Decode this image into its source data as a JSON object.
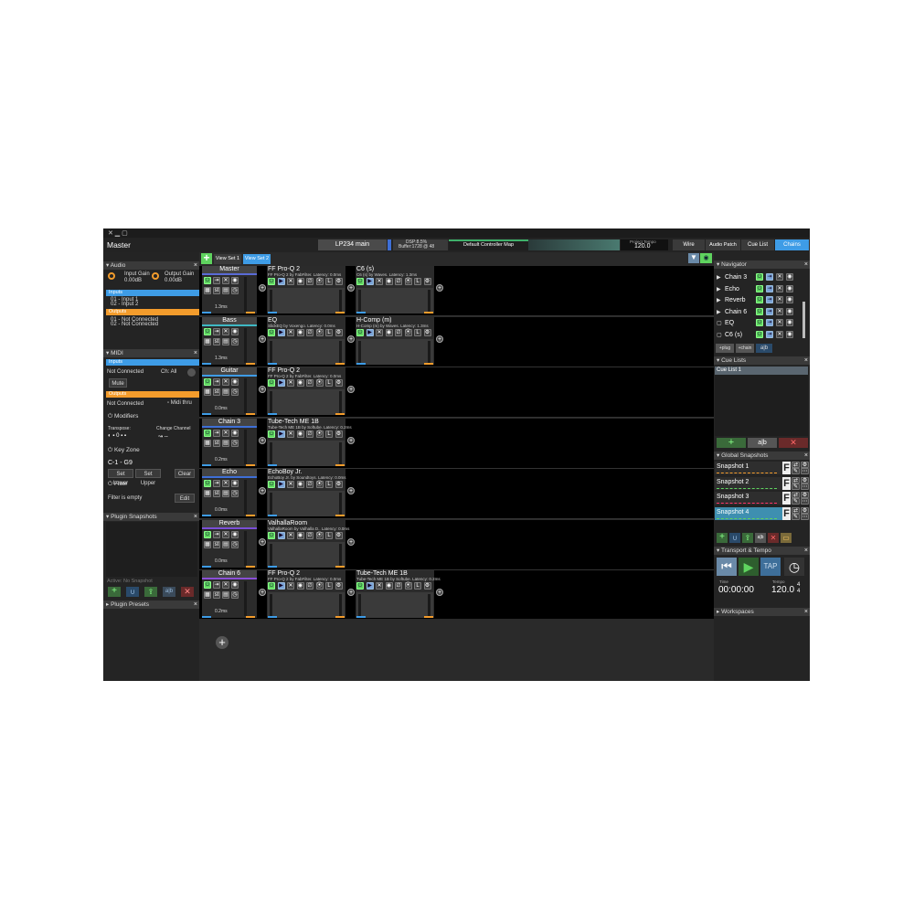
{
  "window": {
    "title": "Master"
  },
  "topbar": {
    "preset": "LP234 main",
    "dsp": "DSP:8.5%",
    "buffer": "Buffer:1728 @ 48",
    "controller_map": "Default Controller Map",
    "tempo_label": "Project Tempo",
    "tempo_value": "120.0",
    "tabs": [
      "Wire",
      "Audio Patch",
      "Cue List",
      "Chains"
    ],
    "active_tab": "Chains"
  },
  "viewsets": [
    "View Set 1",
    "View Set 2"
  ],
  "audio": {
    "title": "Audio",
    "input_gain_label": "Input Gain",
    "input_gain": "0.00dB",
    "output_gain_label": "Output Gain",
    "output_gain": "0.00dB",
    "inputs_label": "Inputs",
    "inputs": [
      "01 - Input 1",
      "02 - Input 2"
    ],
    "outputs_label": "Outputs",
    "outputs": [
      "01 - Not Connected",
      "02 - Not Connected"
    ]
  },
  "midi": {
    "title": "MIDI",
    "inputs_label": "Inputs",
    "input_status": "Not Connected",
    "channel": "Ch: All",
    "mute": "Mute",
    "outputs_label": "Outputs",
    "output_status": "Not Connected",
    "midi_thru": "Midi thru",
    "modifiers": "Modifiers",
    "transpose_label": "Transpose:",
    "transpose_value": "0",
    "change_channel_label": "Change Channel",
    "change_channel_value": "--",
    "key_zone": "Key Zone",
    "range": "C-1 - G9",
    "set_lower": "Set Lower",
    "set_upper": "Set Upper",
    "clear": "Clear",
    "filter": "Filter",
    "filter_status": "Filter is empty",
    "edit": "Edit"
  },
  "plugin_snapshots": {
    "title": "Plugin Snapshots",
    "active": "Active: No Snapshot"
  },
  "plugin_presets": {
    "title": "Plugin Presets"
  },
  "chains": [
    {
      "name": "Master",
      "color": "#5a6bd6",
      "latency": "1.3ms",
      "plugins": [
        {
          "name": "FF Pro-Q 2",
          "sub": "FF Pro-Q 2 by FabFilter. Latency: 0.0ms"
        },
        {
          "name": "C6 (s)",
          "sub": "C6 (s) by Waves. Latency: 1.3ms"
        }
      ]
    },
    {
      "name": "Bass",
      "color": "#3fb8c4",
      "latency": "1.3ms",
      "plugins": [
        {
          "name": "EQ",
          "sub": "SlickEQ by Voxengo. Latency: 0.0ms"
        },
        {
          "name": "H-Comp (m)",
          "sub": "H-Comp (m) by Waves. Latency: 1.3ms"
        }
      ]
    },
    {
      "name": "Guitar",
      "color": "#3e9ce6",
      "latency": "0.0ms",
      "plugins": [
        {
          "name": "FF Pro-Q 2",
          "sub": "FF Pro-Q 2 by FabFilter. Latency: 0.0ms"
        }
      ]
    },
    {
      "name": "Chain 3",
      "color": "#3e6fd6",
      "latency": "0.2ms",
      "plugins": [
        {
          "name": "Tube-Tech ME 1B",
          "sub": "Tube-Tech ME 1B by Softube. Latency: 0.2ms"
        }
      ]
    },
    {
      "name": "Echo",
      "color": "#3e6fd6",
      "latency": "0.0ms",
      "plugins": [
        {
          "name": "EchoBoy Jr.",
          "sub": "EchoBoy Jr. by Soundtoys. Latency: 0.0ms"
        }
      ]
    },
    {
      "name": "Reverb",
      "color": "#7a4fd6",
      "latency": "0.0ms",
      "plugins": [
        {
          "name": "ValhallaRoom",
          "sub": "ValhallaRoom by Valhalla D.. Latency: 0.0ms"
        }
      ]
    },
    {
      "name": "Chain 6",
      "color": "#8a4fd6",
      "latency": "0.2ms",
      "plugins": [
        {
          "name": "FF Pro-Q 2",
          "sub": "FF Pro-Q 2 by FabFilter. Latency: 0.0ms"
        },
        {
          "name": "Tube-Tech ME 1B",
          "sub": "Tube-Tech ME 1B by Softube. Latency: 0.2ms"
        }
      ]
    }
  ],
  "navigator": {
    "title": "Navigator",
    "items": [
      "Chain 3",
      "Echo",
      "Reverb",
      "Chain 6",
      "EQ",
      "C6 (s)"
    ],
    "add_plug": "+plug",
    "add_chain": "+chain"
  },
  "cue_lists": {
    "title": "Cue Lists",
    "items": [
      "Cue List 1"
    ]
  },
  "global_snapshots": {
    "title": "Global Snapshots",
    "items": [
      "Snapshot 1",
      "Snapshot 2",
      "Snapshot 3",
      "Snapshot 4"
    ],
    "selected": "Snapshot 4"
  },
  "transport": {
    "title": "Transport & Tempo",
    "tap": "TAP",
    "time_label": "Time",
    "time": "00:00:00",
    "tempo_label": "Tempo",
    "tempo": "120.0",
    "sig_top": "4",
    "sig_bottom": "4"
  },
  "workspaces": {
    "title": "Workspaces"
  },
  "colors": {
    "accent": "#3e9ce6",
    "orange": "#f39c2c",
    "green": "#5fd35f"
  }
}
